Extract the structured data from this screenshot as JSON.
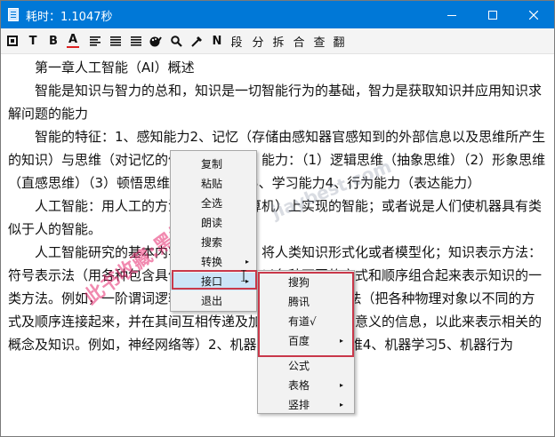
{
  "window": {
    "title": "耗时：1.1047秒"
  },
  "toolbar": {
    "items": [
      {
        "name": "stop-icon",
        "label": ""
      },
      {
        "name": "font-type-icon",
        "label": "T"
      },
      {
        "name": "bold-icon",
        "label": "B"
      },
      {
        "name": "font-color-icon",
        "label": "A"
      },
      {
        "name": "align-left-icon",
        "label": ""
      },
      {
        "name": "align-center-icon",
        "label": ""
      },
      {
        "name": "align-justify-icon",
        "label": ""
      },
      {
        "name": "palette-icon",
        "label": ""
      },
      {
        "name": "search-icon",
        "label": ""
      },
      {
        "name": "translate-icon",
        "label": ""
      },
      {
        "name": "normal-text-icon",
        "label": "N"
      },
      {
        "name": "paragraph-button",
        "label": "段"
      },
      {
        "name": "split-button",
        "label": "分"
      },
      {
        "name": "break-button",
        "label": "拆"
      },
      {
        "name": "merge-button",
        "label": "合"
      },
      {
        "name": "check-button",
        "label": "查"
      },
      {
        "name": "translate-button",
        "label": "翻"
      }
    ]
  },
  "document": {
    "chapter_title": "第一章人工智能（AI）概述",
    "paragraphs": [
      "智能是知识与智力的总和，知识是一切智能行为的基础，智力是获取知识并应用知识求解问题的能力",
      "智能的特征：1、感知能力2、记忆（存储由感知器官感知到的外部信息以及思维所产生的知识）与思维（对记忆的信息进行处理）能力：（1）逻辑思维（抽象思维）（2）形象思维（直感思维）（3）顿悟思维（灵感思维）3、学习能力4、行为能力（表达能力）",
      "人工智能：用人工的方法在机器（计算机）上实现的智能；或者说是人们使机器具有类似于人的智能。",
      "人工智能研究的基本内容：知识表示，将人类知识形式化或者模型化；知识表示方法：符号表示法（用各种包含具体含义的符号，以各种不同的方式和顺序组合起来表示知识的一类方法。例如，一阶谓词逻辑、产生式等）、连接机制表示法（把各种物理对象以不同的方式及顺序连接起来，并在其间互相传递及加工各种包含具体意义的信息，以此来表示相关的概念及知识。例如，神经网络等）2、机器感知 3、机器思维4、机器学习5、机器行为"
    ]
  },
  "context_menu": {
    "items": [
      "复制",
      "粘贴",
      "全选",
      "朗读",
      "搜索",
      "转换",
      "接口",
      "退出"
    ],
    "submenu_indicator": "▸"
  },
  "sub_menu": {
    "items": [
      "搜狗",
      "腾讯",
      "有道√",
      "百度",
      "公式",
      "表格",
      "竖排"
    ]
  },
  "watermark": {
    "left": "此书收藏:黑姐",
    "right": "jiaybest.com"
  }
}
